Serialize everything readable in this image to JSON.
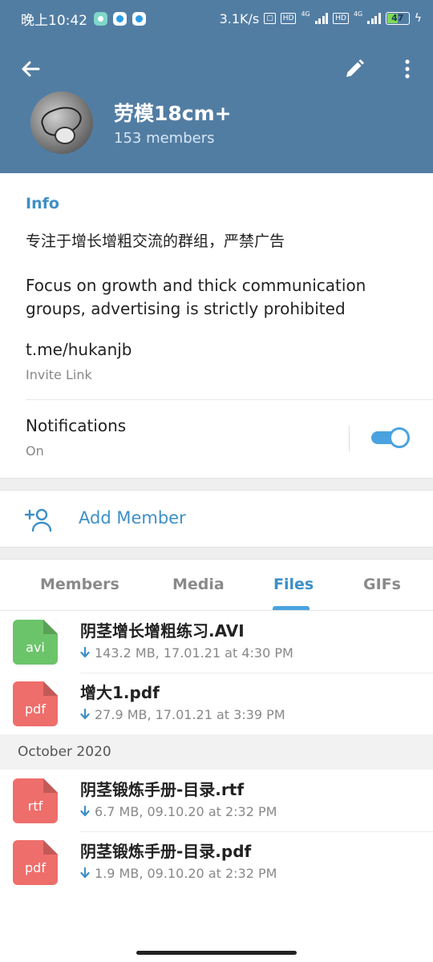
{
  "status_bar": {
    "time": "晚上10:42",
    "net_speed": "3.1K/s",
    "hd1": "HD",
    "hd2": "HD",
    "sig1_label": "4G",
    "sig2_label": "4G",
    "battery": "47"
  },
  "header": {
    "group_name": "劳模18cm+",
    "member_count": "153 members"
  },
  "info": {
    "section_label": "Info",
    "description_cn": "专注于增长增粗交流的群组，严禁广告",
    "description_en": "Focus on growth and thick communication groups, advertising is strictly prohibited",
    "link": "t.me/hukanjb",
    "link_sub": "Invite Link",
    "notifications_label": "Notifications",
    "notifications_state": "On"
  },
  "add_member_label": "Add Member",
  "tabs": [
    {
      "label": "Members"
    },
    {
      "label": "Media"
    },
    {
      "label": "Files"
    },
    {
      "label": "GIFs"
    }
  ],
  "files": [
    {
      "ext": "avi",
      "name": "阴茎增长增粗练习.AVI",
      "meta": "143.2 MB, 17.01.21 at 4:30 PM",
      "color": "#6cc46a"
    },
    {
      "ext": "pdf",
      "name": "增大1.pdf",
      "meta": "27.9 MB, 17.01.21 at 3:39 PM",
      "color": "#ee6e6b"
    },
    {
      "ext": "rtf",
      "name": "阴茎锻炼手册-目录.rtf",
      "meta": "6.7 MB, 09.10.20 at 2:32 PM",
      "color": "#ee6e6b"
    },
    {
      "ext": "pdf",
      "name": "阴茎锻炼手册-目录.pdf",
      "meta": "1.9 MB, 09.10.20 at 2:32 PM",
      "color": "#ee6e6b"
    }
  ],
  "month_header": "October 2020",
  "colors": {
    "header_bg": "#527da3",
    "accent": "#3d8fc7"
  }
}
